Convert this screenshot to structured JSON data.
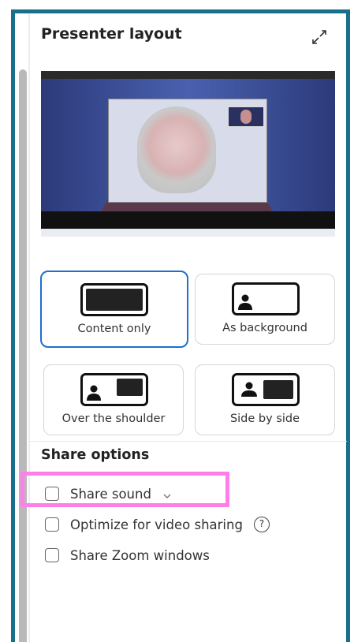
{
  "panel": {
    "title": "Presenter layout",
    "expand_icon": "expand-arrows-icon"
  },
  "layouts": [
    {
      "label": "Content only",
      "icon": "content-only-icon",
      "selected": true
    },
    {
      "label": "As background",
      "icon": "as-background-icon",
      "selected": false
    },
    {
      "label": "Over the shoulder",
      "icon": "over-the-shoulder-icon",
      "selected": false
    },
    {
      "label": "Side by side",
      "icon": "side-by-side-icon",
      "selected": false
    }
  ],
  "share_options": {
    "heading": "Share options",
    "items": [
      {
        "label": "Share sound",
        "checked": false,
        "has_dropdown": true,
        "highlighted": true
      },
      {
        "label": "Optimize for video sharing",
        "checked": false,
        "has_help": true,
        "help_glyph": "?"
      },
      {
        "label": "Share Zoom windows",
        "checked": false
      }
    ]
  },
  "colors": {
    "frame_border": "#1a6f8c",
    "selected_border": "#1e6fd0",
    "highlight": "#ff7eea"
  }
}
